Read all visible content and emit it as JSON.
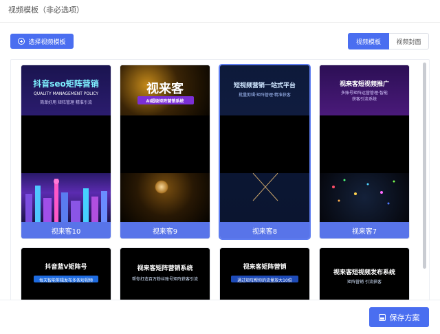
{
  "header": {
    "title": "视频模板（非必选项）"
  },
  "toolbar": {
    "select_label": "选择视频模板",
    "tabs": [
      {
        "label": "视频模板",
        "active": true
      },
      {
        "label": "视频封面",
        "active": false
      }
    ]
  },
  "templates": [
    {
      "name": "视来客10",
      "headline": "抖音seo矩阵营销",
      "sub": "QUALITY MANAGEMENT POLICY",
      "sub2": "简单好用 矩阵管理 精准引流"
    },
    {
      "name": "视来客9",
      "headline": "视来客",
      "sub": "AI超级矩阵营销系统"
    },
    {
      "name": "视来客8",
      "headline": "短视频营销一站式平台",
      "sub": "批量剪辑·矩阵管理·精准获客"
    },
    {
      "name": "视来客7",
      "headline": "视来客短视频推广",
      "sub": "多账号矩阵运营管理·智能",
      "sub2": "获客引流系统"
    },
    {
      "headline": "抖音蓝V矩阵号",
      "sub": "每天智能剪辑发布多条短视频"
    },
    {
      "headline": "视来客矩阵营销系统",
      "sub": "帮你打造百万粉丝账号矩阵获客引流"
    },
    {
      "headline": "视来客矩阵营销",
      "sub": "通过矩阵帮你的流量放大10倍"
    },
    {
      "headline": "视来客短视频发布系统",
      "sub": "矩阵营销  引流获客"
    }
  ],
  "footer": {
    "save_label": "保存方案"
  },
  "colors": {
    "accent": "#4a6ef0",
    "label_bg": "#5874e9"
  }
}
